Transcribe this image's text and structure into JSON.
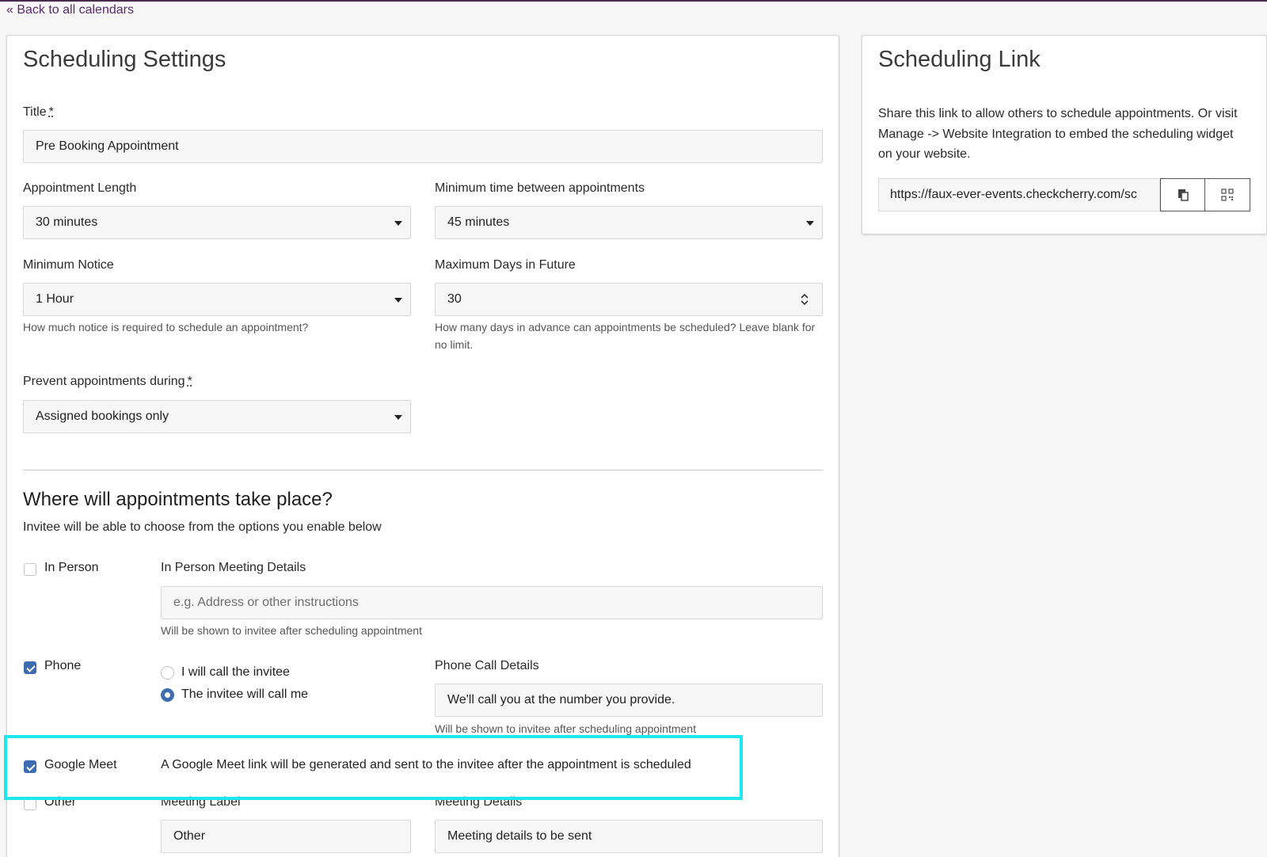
{
  "back_link": "« Back to all calendars",
  "settings": {
    "title": "Scheduling Settings",
    "title_field": {
      "label": "Title",
      "required_mark": "*",
      "value": "Pre Booking Appointment"
    },
    "appointment_length": {
      "label": "Appointment Length",
      "value": "30 minutes"
    },
    "min_time_between": {
      "label": "Minimum time between appointments",
      "value": "45 minutes"
    },
    "min_notice": {
      "label": "Minimum Notice",
      "value": "1 Hour",
      "help": "How much notice is required to schedule an appointment?"
    },
    "max_days": {
      "label": "Maximum Days in Future",
      "value": "30",
      "help": "How many days in advance can appointments be scheduled? Leave blank for no limit."
    },
    "prevent": {
      "label": "Prevent appointments during",
      "required_mark": "*",
      "value": "Assigned bookings only"
    }
  },
  "location": {
    "title": "Where will appointments take place?",
    "subtitle": "Invitee will be able to choose from the options you enable below",
    "in_person": {
      "label": "In Person",
      "checked": false,
      "details_label": "In Person Meeting Details",
      "placeholder": "e.g. Address or other instructions",
      "help": "Will be shown to invitee after scheduling appointment"
    },
    "phone": {
      "label": "Phone",
      "checked": true,
      "option_1": "I will call the invitee",
      "option_2": "The invitee will call me",
      "details_label": "Phone Call Details",
      "details_value": "We'll call you at the number you provide.",
      "help": "Will be shown to invitee after scheduling appointment"
    },
    "google_meet": {
      "label": "Google Meet",
      "checked": true,
      "description": "A Google Meet link will be generated and sent to the invitee after the appointment is scheduled"
    },
    "other": {
      "label": "Other",
      "checked": false,
      "meeting_label_label": "Meeting Label",
      "meeting_label_value": "Other",
      "details_label": "Meeting Details",
      "details_value": "Meeting details to be sent"
    }
  },
  "scheduling_link": {
    "title": "Scheduling Link",
    "description": "Share this link to allow others to schedule appointments. Or visit Manage -> Website Integration to embed the scheduling widget on your website.",
    "url": "https://faux-ever-events.checkcherry.com/sc",
    "copy_icon": "copy-icon",
    "qr_icon": "qr-code-icon"
  },
  "colors": {
    "accent": "#3d6db0",
    "highlight": "#1de8ee",
    "top_bar": "#4b2a4f",
    "link": "#5b2a6b"
  }
}
